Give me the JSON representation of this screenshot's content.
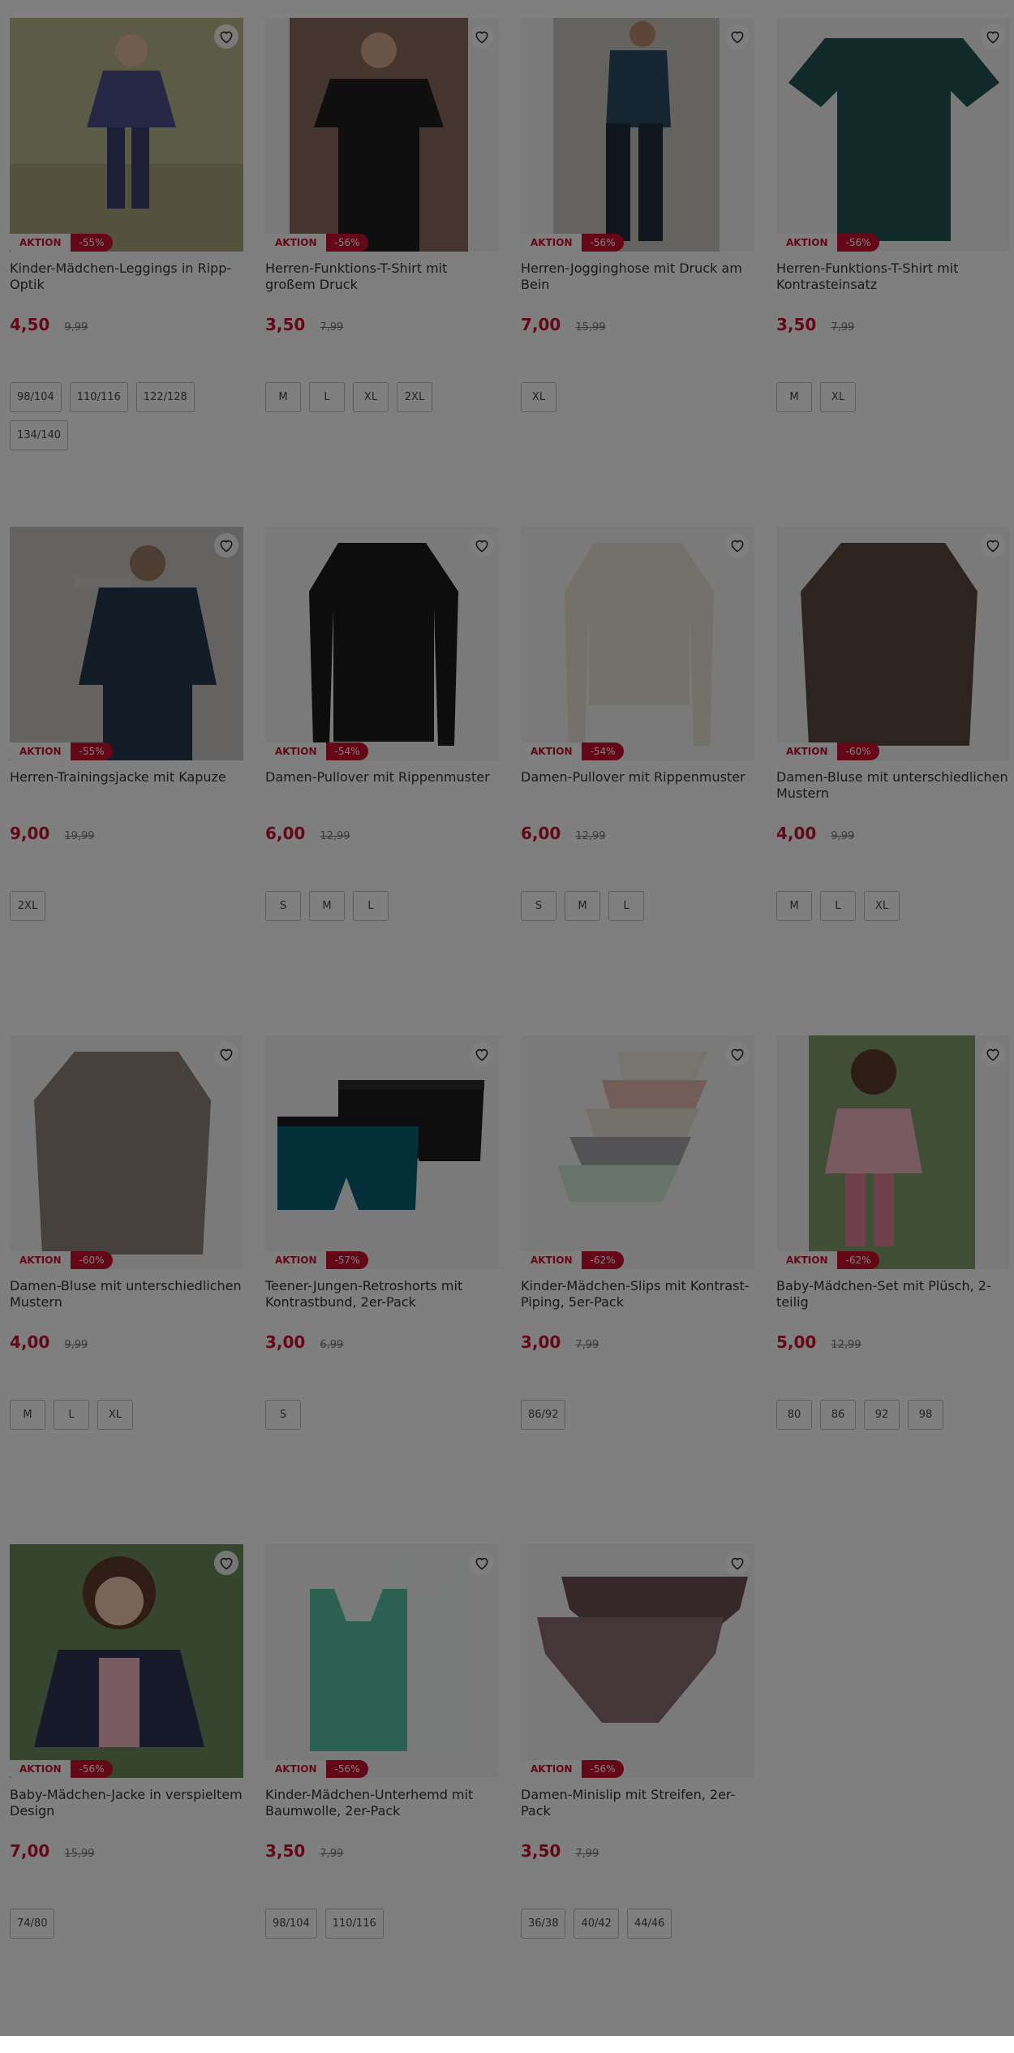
{
  "colors": {
    "sale_red": "#c8102e",
    "overlay": "rgba(0,0,0,0.5)"
  },
  "products": [
    {
      "title": "Kinder-Mädchen-Leggings in Ripp-Optik",
      "badge": "AKTION",
      "discount": "-55%",
      "price": "4,50",
      "old_price": "9,99",
      "sizes": [
        "98/104",
        "110/116",
        "122/128",
        "134/140"
      ],
      "image": "girl-jacket-leggings",
      "bg": "#b9b68a",
      "fg": "#3a3f6e"
    },
    {
      "title": "Herren-Funktions-T-Shirt mit großem Druck",
      "badge": "AKTION",
      "discount": "-56%",
      "price": "3,50",
      "old_price": "7,99",
      "sizes": [
        "M",
        "L",
        "XL",
        "2XL"
      ],
      "image": "man-black-tshirt",
      "bg": "#8a6a5e",
      "fg": "#1f1f1f"
    },
    {
      "title": "Herren-Jogginghose mit Druck am Bein",
      "badge": "AKTION",
      "discount": "-56%",
      "price": "7,00",
      "old_price": "15,99",
      "sizes": [
        "XL"
      ],
      "image": "man-jogging-pants",
      "bg": "#c9c6bf",
      "fg": "#1e2c3a"
    },
    {
      "title": "Herren-Funktions-T-Shirt mit Kontrasteinsatz",
      "badge": "AKTION",
      "discount": "-56%",
      "price": "3,50",
      "old_price": "7,99",
      "sizes": [
        "M",
        "XL"
      ],
      "image": "green-tshirt",
      "bg": "#f4f4f4",
      "fg": "#1f5453"
    },
    {
      "title": "Herren-Trainingsjacke mit Kapuze",
      "badge": "AKTION",
      "discount": "-55%",
      "price": "9,00",
      "old_price": "19,99",
      "sizes": [
        "2XL"
      ],
      "image": "man-training-jacket",
      "bg": "#c8c6c2",
      "fg": "#23384d"
    },
    {
      "title": "Damen-Pullover mit Rippenmuster",
      "badge": "AKTION",
      "discount": "-54%",
      "price": "6,00",
      "old_price": "12,99",
      "sizes": [
        "S",
        "M",
        "L"
      ],
      "image": "black-pullover",
      "bg": "#f4f4f4",
      "fg": "#1a1a1a"
    },
    {
      "title": "Damen-Pullover mit Rippenmuster",
      "badge": "AKTION",
      "discount": "-54%",
      "price": "6,00",
      "old_price": "12,99",
      "sizes": [
        "S",
        "M",
        "L"
      ],
      "image": "cream-pullover",
      "bg": "#f4f4f4",
      "fg": "#e9e3d6"
    },
    {
      "title": "Damen-Bluse mit unterschiedlichen Mustern",
      "badge": "AKTION",
      "discount": "-60%",
      "price": "4,00",
      "old_price": "9,99",
      "sizes": [
        "M",
        "L",
        "XL"
      ],
      "image": "brown-blouse",
      "bg": "#f4f4f4",
      "fg": "#5a4840"
    },
    {
      "title": "Damen-Bluse mit unterschiedlichen Mustern",
      "badge": "AKTION",
      "discount": "-60%",
      "price": "4,00",
      "old_price": "9,99",
      "sizes": [
        "M",
        "L",
        "XL"
      ],
      "image": "striped-blouse",
      "bg": "#f4f4f4",
      "fg": "#8d8279"
    },
    {
      "title": "Teener-Jungen-Retroshorts mit Kontrastbund, 2er-Pack",
      "badge": "AKTION",
      "discount": "-57%",
      "price": "3,00",
      "old_price": "6,99",
      "sizes": [
        "S"
      ],
      "image": "retro-shorts",
      "bg": "#f4f4f4",
      "fg": "#0b5f74"
    },
    {
      "title": "Kinder-Mädchen-Slips mit Kontrast-Piping, 5er-Pack",
      "badge": "AKTION",
      "discount": "-62%",
      "price": "3,00",
      "old_price": "7,99",
      "sizes": [
        "86/92"
      ],
      "image": "girls-slips",
      "bg": "#f4f4f4",
      "fg": "#e8b8b2"
    },
    {
      "title": "Baby-Mädchen-Set mit Plüsch, 2-teilig",
      "badge": "AKTION",
      "discount": "-62%",
      "price": "5,00",
      "old_price": "12,99",
      "sizes": [
        "80",
        "86",
        "92",
        "98"
      ],
      "image": "baby-pink-set",
      "bg": "#7f9c6a",
      "fg": "#f0b7c0"
    },
    {
      "title": "Baby-Mädchen-Jacke in verspieltem Design",
      "badge": "AKTION",
      "discount": "-56%",
      "price": "7,00",
      "old_price": "15,99",
      "sizes": [
        "74/80"
      ],
      "image": "baby-jacket",
      "bg": "#6d8d5c",
      "fg": "#2a3355"
    },
    {
      "title": "Kinder-Mädchen-Unterhemd mit Baumwolle, 2er-Pack",
      "badge": "AKTION",
      "discount": "-56%",
      "price": "3,50",
      "old_price": "7,99",
      "sizes": [
        "98/104",
        "110/116"
      ],
      "image": "girls-undershirts",
      "bg": "#f4f4f4",
      "fg": "#58c3a4"
    },
    {
      "title": "Damen-Minislip mit Streifen, 2er-Pack",
      "badge": "AKTION",
      "discount": "-56%",
      "price": "3,50",
      "old_price": "7,99",
      "sizes": [
        "36/38",
        "40/42",
        "44/46"
      ],
      "image": "minislip-striped",
      "bg": "#f4f4f4",
      "fg": "#8a6c72"
    }
  ]
}
